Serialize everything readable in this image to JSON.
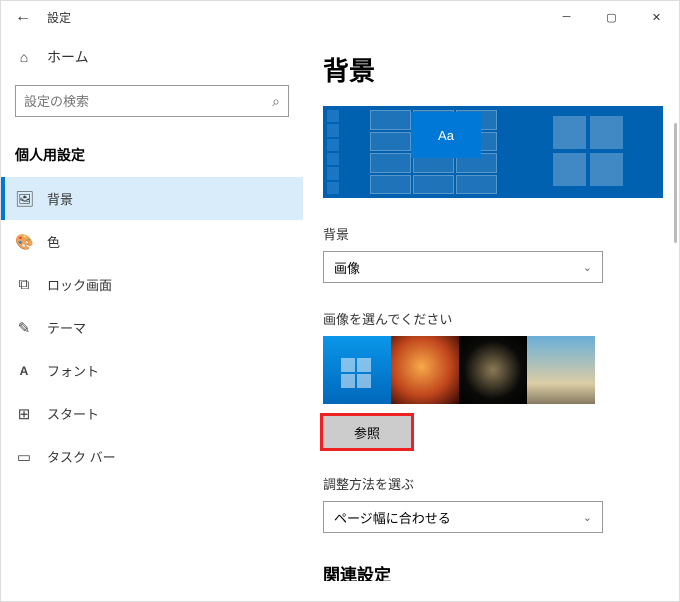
{
  "titlebar": {
    "title": "設定"
  },
  "sidebar": {
    "home": "ホーム",
    "search_placeholder": "設定の検索",
    "section": "個人用設定",
    "items": [
      {
        "label": "背景"
      },
      {
        "label": "色"
      },
      {
        "label": "ロック画面"
      },
      {
        "label": "テーマ"
      },
      {
        "label": "フォント"
      },
      {
        "label": "スタート"
      },
      {
        "label": "タスク バー"
      }
    ]
  },
  "content": {
    "heading": "背景",
    "preview_Aa": "Aa",
    "bg_label": "背景",
    "bg_value": "画像",
    "choose_label": "画像を選んでください",
    "browse": "参照",
    "fit_label": "調整方法を選ぶ",
    "fit_value": "ページ幅に合わせる",
    "related": "関連設定"
  }
}
